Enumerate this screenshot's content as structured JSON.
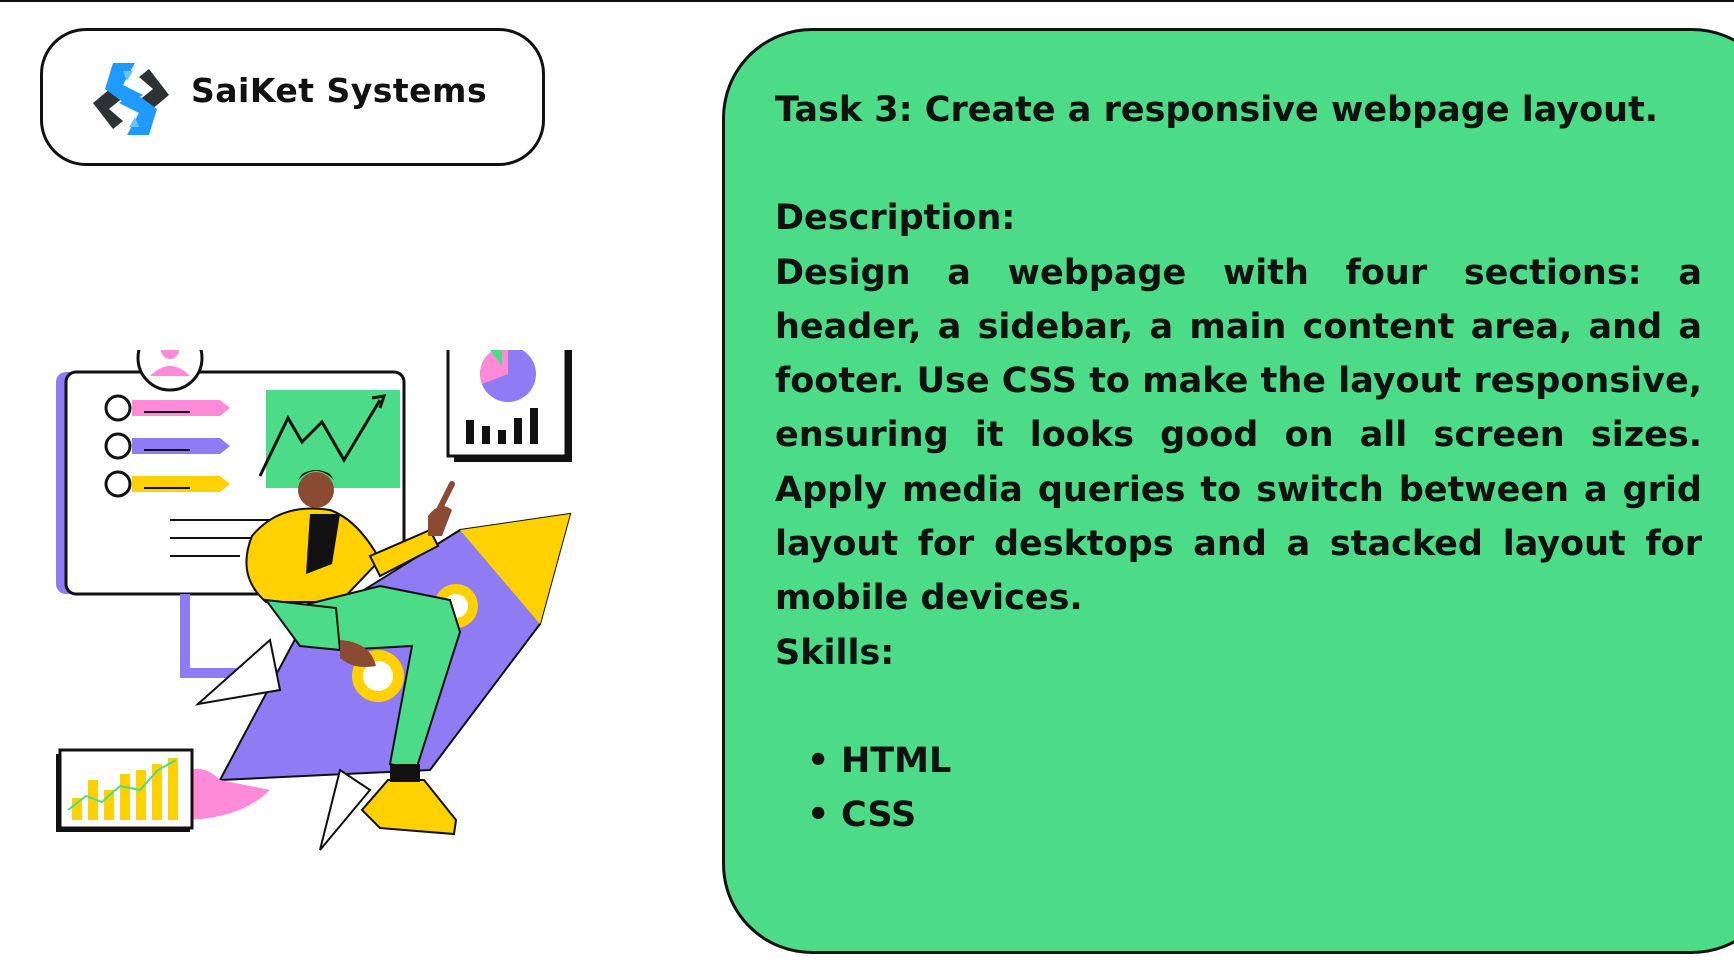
{
  "brand": {
    "name": "SaiKet Systems",
    "colors": {
      "primary_blue": "#1f9bff",
      "dark": "#2f3235"
    }
  },
  "task": {
    "title": "Task 3: Create a responsive webpage layout.",
    "description_heading": "Description:",
    "description_body": "Design a webpage with four sections: a header, a sidebar, a main content area, and a footer. Use CSS to make the layout responsive, ensuring it looks good on all screen sizes. Apply media queries to switch between a grid layout for desktops and a stacked layout for mobile devices.",
    "skills_heading": "Skills:",
    "skills": [
      "HTML",
      "CSS"
    ],
    "panel_color": "#4cdb86"
  },
  "illustration": {
    "name": "person-on-rocket-dashboard-illustration",
    "colors": {
      "yellow": "#ffd100",
      "purple": "#8f7cf4",
      "green": "#4cdb86",
      "pink": "#ff8ad8"
    }
  }
}
